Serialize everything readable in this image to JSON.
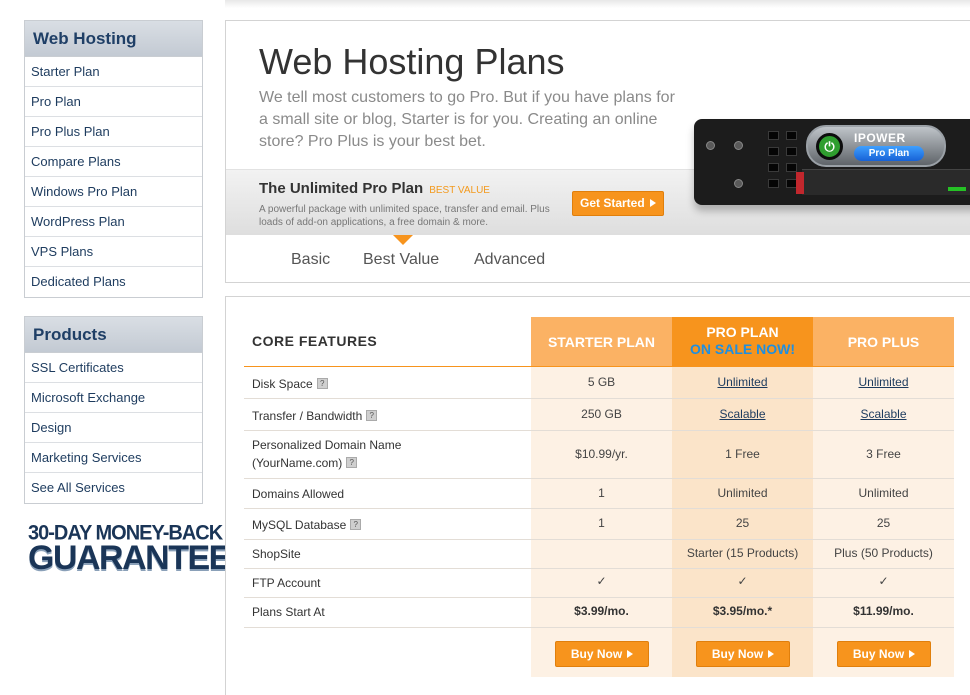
{
  "sidebar": {
    "hosting": {
      "title": "Web Hosting",
      "items": [
        "Starter Plan",
        "Pro Plan",
        "Pro Plus Plan",
        "Compare Plans",
        "Windows Pro Plan",
        "WordPress Plan",
        "VPS Plans",
        "Dedicated Plans"
      ]
    },
    "products": {
      "title": "Products",
      "items": [
        "SSL Certificates",
        "Microsoft Exchange",
        "Design",
        "Marketing Services",
        "See All Services"
      ]
    },
    "guarantee": {
      "line1": "30-DAY MONEY-BACK",
      "line2": "GUARANTEE"
    }
  },
  "hero": {
    "title": "Web Hosting Plans",
    "description": "We tell most customers to go Pro. But if you have plans for a small site or blog, Starter is for you. Creating an online store? Pro Plus is your best bet.",
    "featured_title": "The Unlimited Pro Plan",
    "featured_tag": "BEST VALUE",
    "featured_desc": "A powerful package with unlimited space, transfer and email. Plus loads of add-on applications, a free domain & more.",
    "cta_label": "Get Started",
    "server_brand": "IPOWER",
    "server_plan": "Pro Plan",
    "tabs": [
      "Basic",
      "Best Value",
      "Advanced"
    ]
  },
  "table": {
    "core_label": "CORE FEATURES",
    "plans": [
      "STARTER PLAN",
      "PRO PLAN",
      "PRO PLUS"
    ],
    "pro_sale": "ON SALE NOW!",
    "help_glyph": "?",
    "check_glyph": "✓",
    "rows": [
      {
        "feature": "Disk Space",
        "help": true,
        "values": [
          "5 GB",
          "Unlimited",
          "Unlimited"
        ]
      },
      {
        "feature": "Transfer / Bandwidth",
        "help": true,
        "values": [
          "250 GB",
          "Scalable",
          "Scalable"
        ]
      },
      {
        "feature_line1": "Personalized Domain Name",
        "feature_line2": "(YourName.com)",
        "help": true,
        "values": [
          "$10.99/yr.",
          "1 Free",
          "3 Free"
        ]
      },
      {
        "feature": "Domains Allowed",
        "values": [
          "1",
          "Unlimited",
          "Unlimited"
        ]
      },
      {
        "feature": "MySQL Database",
        "help": true,
        "values": [
          "1",
          "25",
          "25"
        ]
      },
      {
        "feature": "ShopSite",
        "values": [
          "",
          "Starter (15 Products)",
          "Plus (50 Products)"
        ]
      },
      {
        "feature": "FTP Account",
        "values": [
          "check",
          "check",
          "check"
        ]
      },
      {
        "feature": "Plans Start At",
        "values": [
          "$3.99/mo.",
          "$3.95/mo.*",
          "$11.99/mo."
        ]
      }
    ],
    "buy_label": "Buy Now"
  },
  "colors": {
    "accent": "#f7941d",
    "accent_light": "#fbb264",
    "nav_text": "#1d3b5e",
    "sale_blue": "#1f8fe0"
  }
}
